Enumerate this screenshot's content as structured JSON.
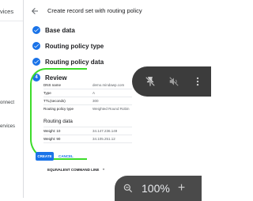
{
  "left_panel": {
    "title": "vices",
    "item1": "onnect",
    "item2": "ervices"
  },
  "header": {
    "title": "Create record set with routing policy"
  },
  "steps": [
    {
      "label": "Base data"
    },
    {
      "label": "Routing policy type"
    },
    {
      "label": "Routing policy data"
    }
  ],
  "review": {
    "number": "4",
    "label": "Review",
    "rows": [
      {
        "key": "DNS name",
        "value": "demo.mindawp.com"
      },
      {
        "key": "Type",
        "value": "A"
      },
      {
        "key": "TTL(seconds)",
        "value": "300"
      },
      {
        "key": "Routing policy type",
        "value": "Weighted Round Robin"
      }
    ],
    "routing_title": "Routing data",
    "routing_rows": [
      {
        "key": "Weight: 10",
        "value": "34.147.236.149"
      },
      {
        "key": "Weight: 90",
        "value": "34.105.251.12"
      }
    ]
  },
  "buttons": {
    "create": "CREATE",
    "cancel": "CANCEL",
    "equivalent": "EQUIVALENT COMMAND LINE"
  },
  "zoom": {
    "value": "100%",
    "plus": "+"
  },
  "colors": {
    "accent": "#1a73e8",
    "annotation": "#3ddc2a",
    "overlay": "#3c3c3c"
  }
}
